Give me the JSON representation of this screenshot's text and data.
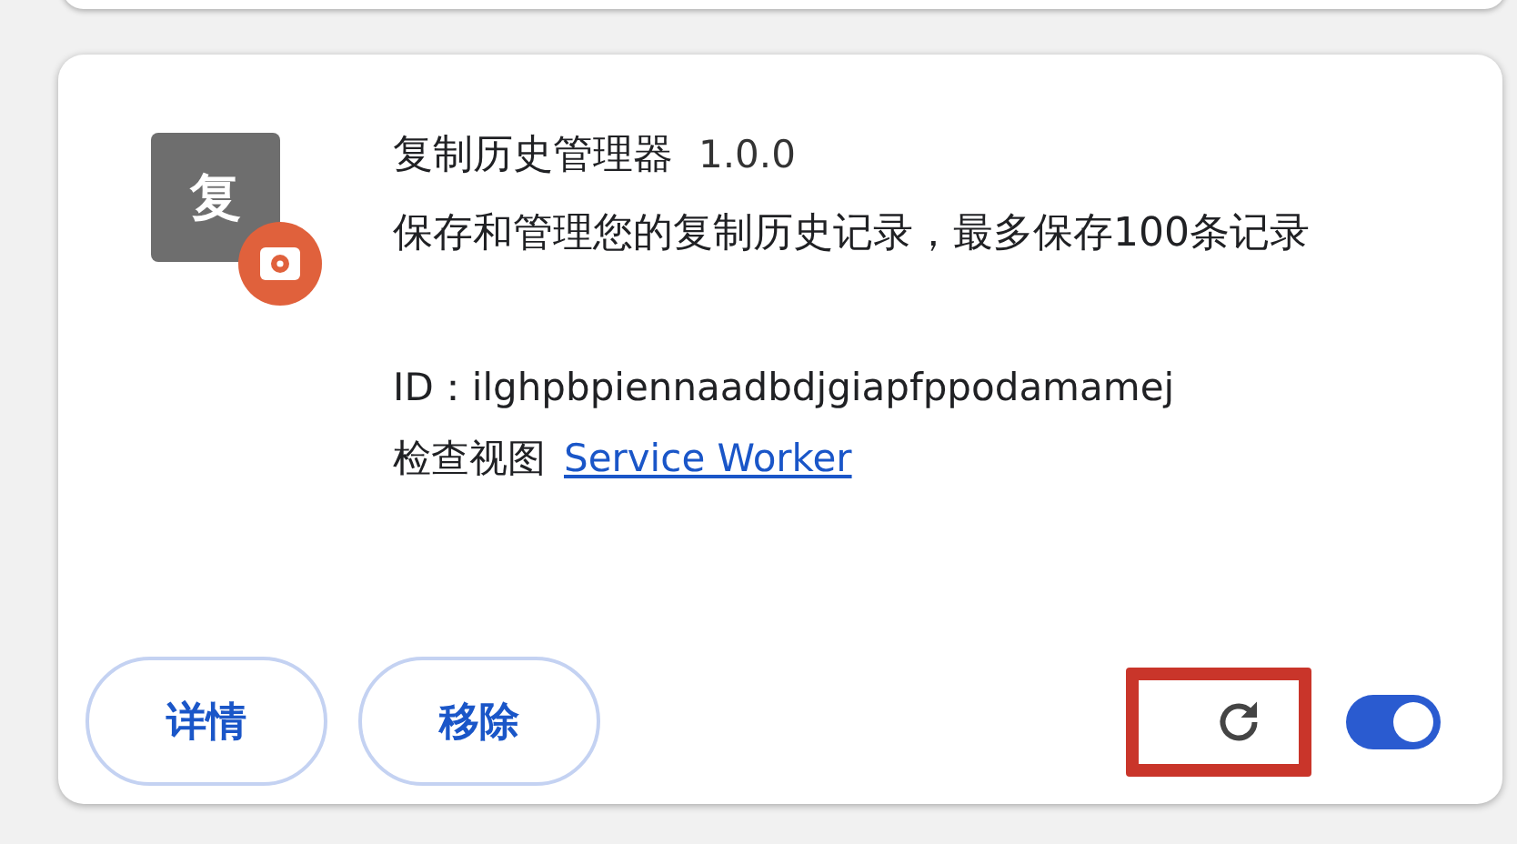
{
  "extension": {
    "icon_text": "复",
    "name": "复制历史管理器",
    "version": "1.0.0",
    "description": "保存和管理您的复制历史记录，最多保存100条记录",
    "id_label": "ID：",
    "id": "ilghpbpiennaadbdjgiapfppodamamej",
    "inspect_label": "检查视图",
    "inspect_link": "Service Worker",
    "buttons": [
      "详情",
      "移除"
    ],
    "reload_highlighted": true,
    "enabled": true
  }
}
